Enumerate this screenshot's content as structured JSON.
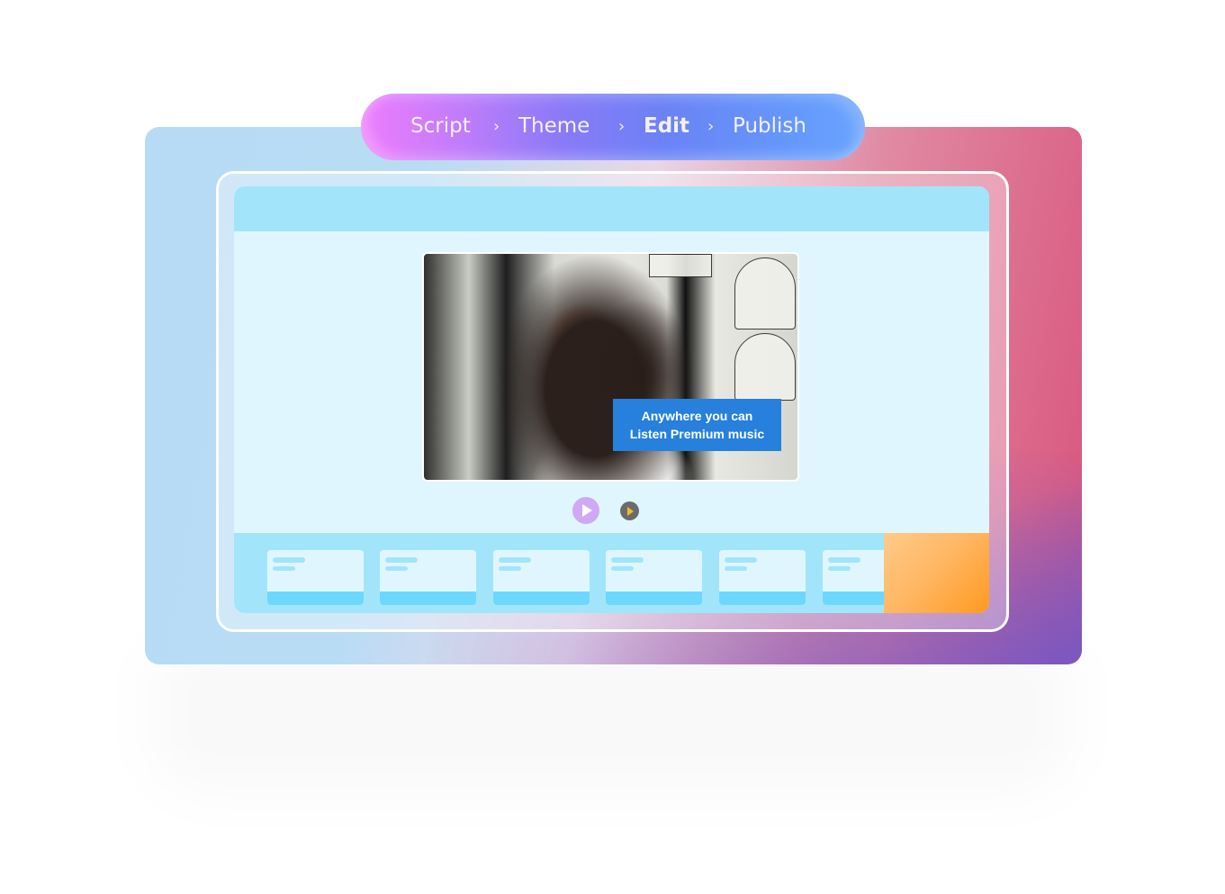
{
  "workflow_steps": [
    {
      "label": "Script",
      "active": false
    },
    {
      "label": "Theme",
      "active": false
    },
    {
      "label": "Edit",
      "active": true
    },
    {
      "label": "Publish",
      "active": false
    }
  ],
  "step_separator": "›",
  "preview": {
    "image_description": "woman with headphones dancing in front of poster wall",
    "caption_line1": "Anywhere you can",
    "caption_line2": "Listen Premium music"
  },
  "playback": {
    "primary_icon": "play-icon",
    "secondary_icon": "play-icon"
  },
  "timeline": {
    "thumbnail_count": 6
  },
  "colors": {
    "caption_bg": "#2680dc",
    "app_header": "#a2e5fb",
    "app_body": "#e0f6ff",
    "thumb_bar": "#6dd8ff",
    "play_primary": "#cfa9f5",
    "play_secondary": "#6b6b6b",
    "play_secondary_glyph": "#f4b92a",
    "accent_orange": "#ff9a1f",
    "backdrop_pink": "#d9557e",
    "backdrop_purple": "#6a58cc",
    "backdrop_blue": "#b8dbf5"
  }
}
